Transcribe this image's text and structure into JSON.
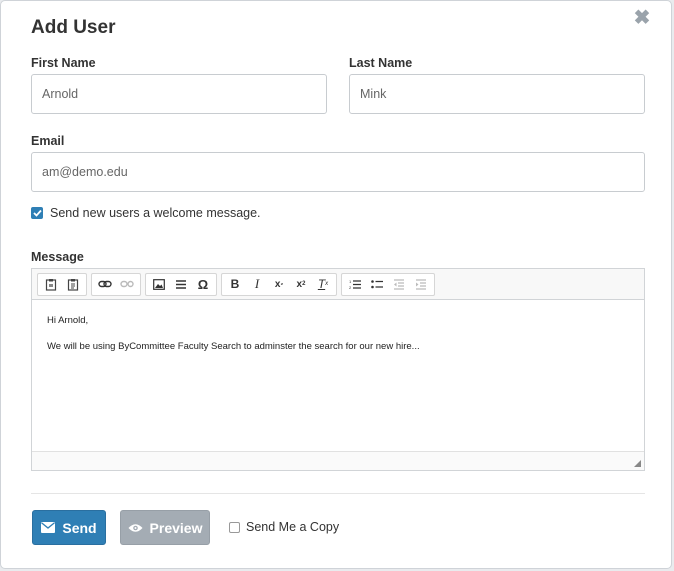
{
  "modal": {
    "title": "Add User",
    "close_icon": "close-icon"
  },
  "form": {
    "first_name_label": "First Name",
    "first_name_value": "Arnold",
    "last_name_label": "Last Name",
    "last_name_value": "Mink",
    "email_label": "Email",
    "email_value": "am@demo.edu",
    "welcome_checkbox_label": "Send new users a welcome message.",
    "welcome_checked": true,
    "message_label": "Message"
  },
  "editor": {
    "toolbar_icons": [
      "paste-icon",
      "paste-text-icon",
      "link-icon",
      "unlink-icon",
      "image-icon",
      "horizontal-line-icon",
      "special-char-icon",
      "bold-icon",
      "italic-icon",
      "subscript-icon",
      "superscript-icon",
      "remove-format-icon",
      "numbered-list-icon",
      "bulleted-list-icon",
      "outdent-icon",
      "indent-icon"
    ],
    "line1": "Hi Arnold,",
    "line2": "We will be using ByCommittee Faculty Search to adminster the search for our new hire..."
  },
  "footer": {
    "send_label": "Send",
    "preview_label": "Preview",
    "copy_label": "Send Me a Copy",
    "copy_checked": false
  },
  "colors": {
    "primary": "#2f7fb5",
    "secondary": "#a4acb4"
  }
}
